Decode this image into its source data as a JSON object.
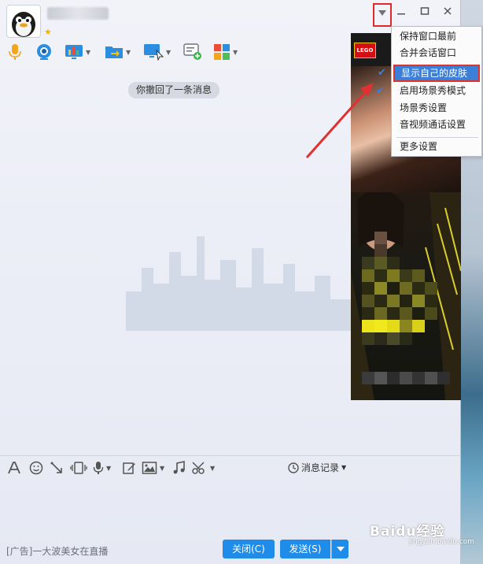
{
  "chat": {
    "recall_notice": "你撤回了一条消息"
  },
  "menu": {
    "items": [
      {
        "label": "保持窗口最前",
        "checked": false,
        "selected": false
      },
      {
        "label": "合并会话窗口",
        "checked": false,
        "selected": false
      },
      {
        "label": "显示自己的皮肤",
        "checked": true,
        "selected": true
      },
      {
        "label": "启用场景秀模式",
        "checked": true,
        "selected": false
      },
      {
        "label": "场景秀设置",
        "checked": false,
        "selected": false
      },
      {
        "label": "音视频通话设置",
        "checked": false,
        "selected": false
      },
      {
        "label": "更多设置",
        "checked": false,
        "selected": false
      }
    ]
  },
  "input_toolbar": {
    "history_label": "消息记录"
  },
  "footer": {
    "ad_text": "[广告]一大波美女在直播",
    "close_label": "关闭(C)",
    "send_label": "发送(S)"
  },
  "ad": {
    "brand": "LEGO"
  },
  "watermark": {
    "text": "Baidu经验",
    "sub": "jingyan.baidu.com"
  },
  "colors": {
    "accent": "#1e8ce8",
    "highlight_border": "#e0342b",
    "menu_selected": "#3b7fd9"
  },
  "icons": [
    "minimize-icon",
    "maximize-icon",
    "close-icon",
    "menu-arrow-icon",
    "voice-icon",
    "video-icon",
    "screen-share-icon",
    "file-transfer-icon",
    "remote-assist-icon",
    "add-app-icon",
    "apps-grid-icon",
    "font-icon",
    "emoji-icon",
    "poke-icon",
    "shake-icon",
    "voice-message-icon",
    "edit-icon",
    "image-icon",
    "music-icon",
    "screenshot-icon",
    "clock-icon"
  ]
}
